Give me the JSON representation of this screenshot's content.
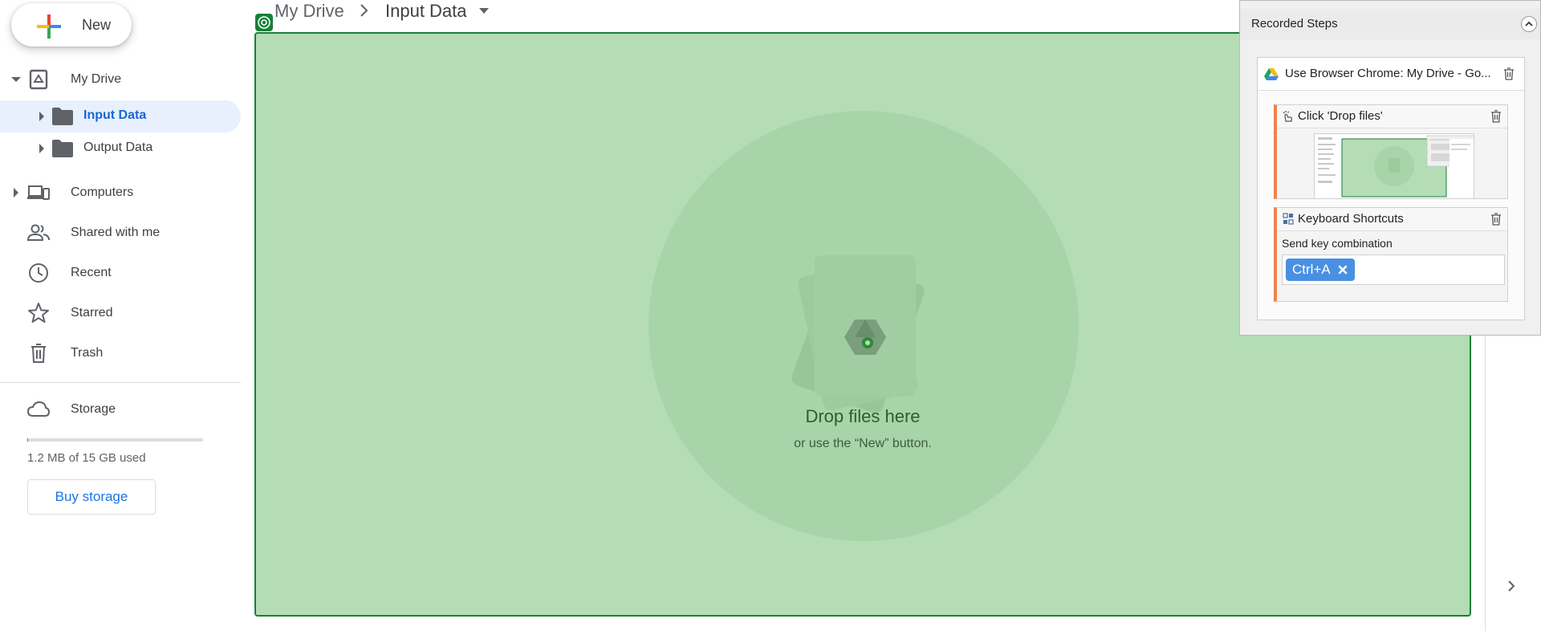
{
  "new_button": {
    "label": "New"
  },
  "nav": {
    "my_drive": "My Drive",
    "tree": [
      {
        "label": "Input Data"
      },
      {
        "label": "Output Data"
      }
    ],
    "computers": "Computers",
    "shared": "Shared with me",
    "recent": "Recent",
    "starred": "Starred",
    "trash": "Trash",
    "storage": "Storage"
  },
  "storage": {
    "used_text": "1.2 MB of 15 GB used",
    "used_fraction": 0.0001,
    "buy_label": "Buy storage"
  },
  "breadcrumb": {
    "root": "My Drive",
    "current": "Input Data"
  },
  "dropzone": {
    "title": "Drop files here",
    "subtitle": "or use the “New” button."
  },
  "recorded_steps": {
    "title": "Recorded Steps",
    "action_title": "Use Browser Chrome: My Drive - Go...",
    "steps": [
      {
        "title": "Click 'Drop files'"
      },
      {
        "title": "Keyboard Shortcuts",
        "description": "Send key combination",
        "key": "Ctrl+A"
      }
    ]
  },
  "colors": {
    "drop_bg": "#b4ddb6",
    "drop_border": "#188038",
    "selected_bg": "#e8f0fe",
    "accent_blue": "#1a73e8",
    "step_accent": "#f0834d"
  }
}
